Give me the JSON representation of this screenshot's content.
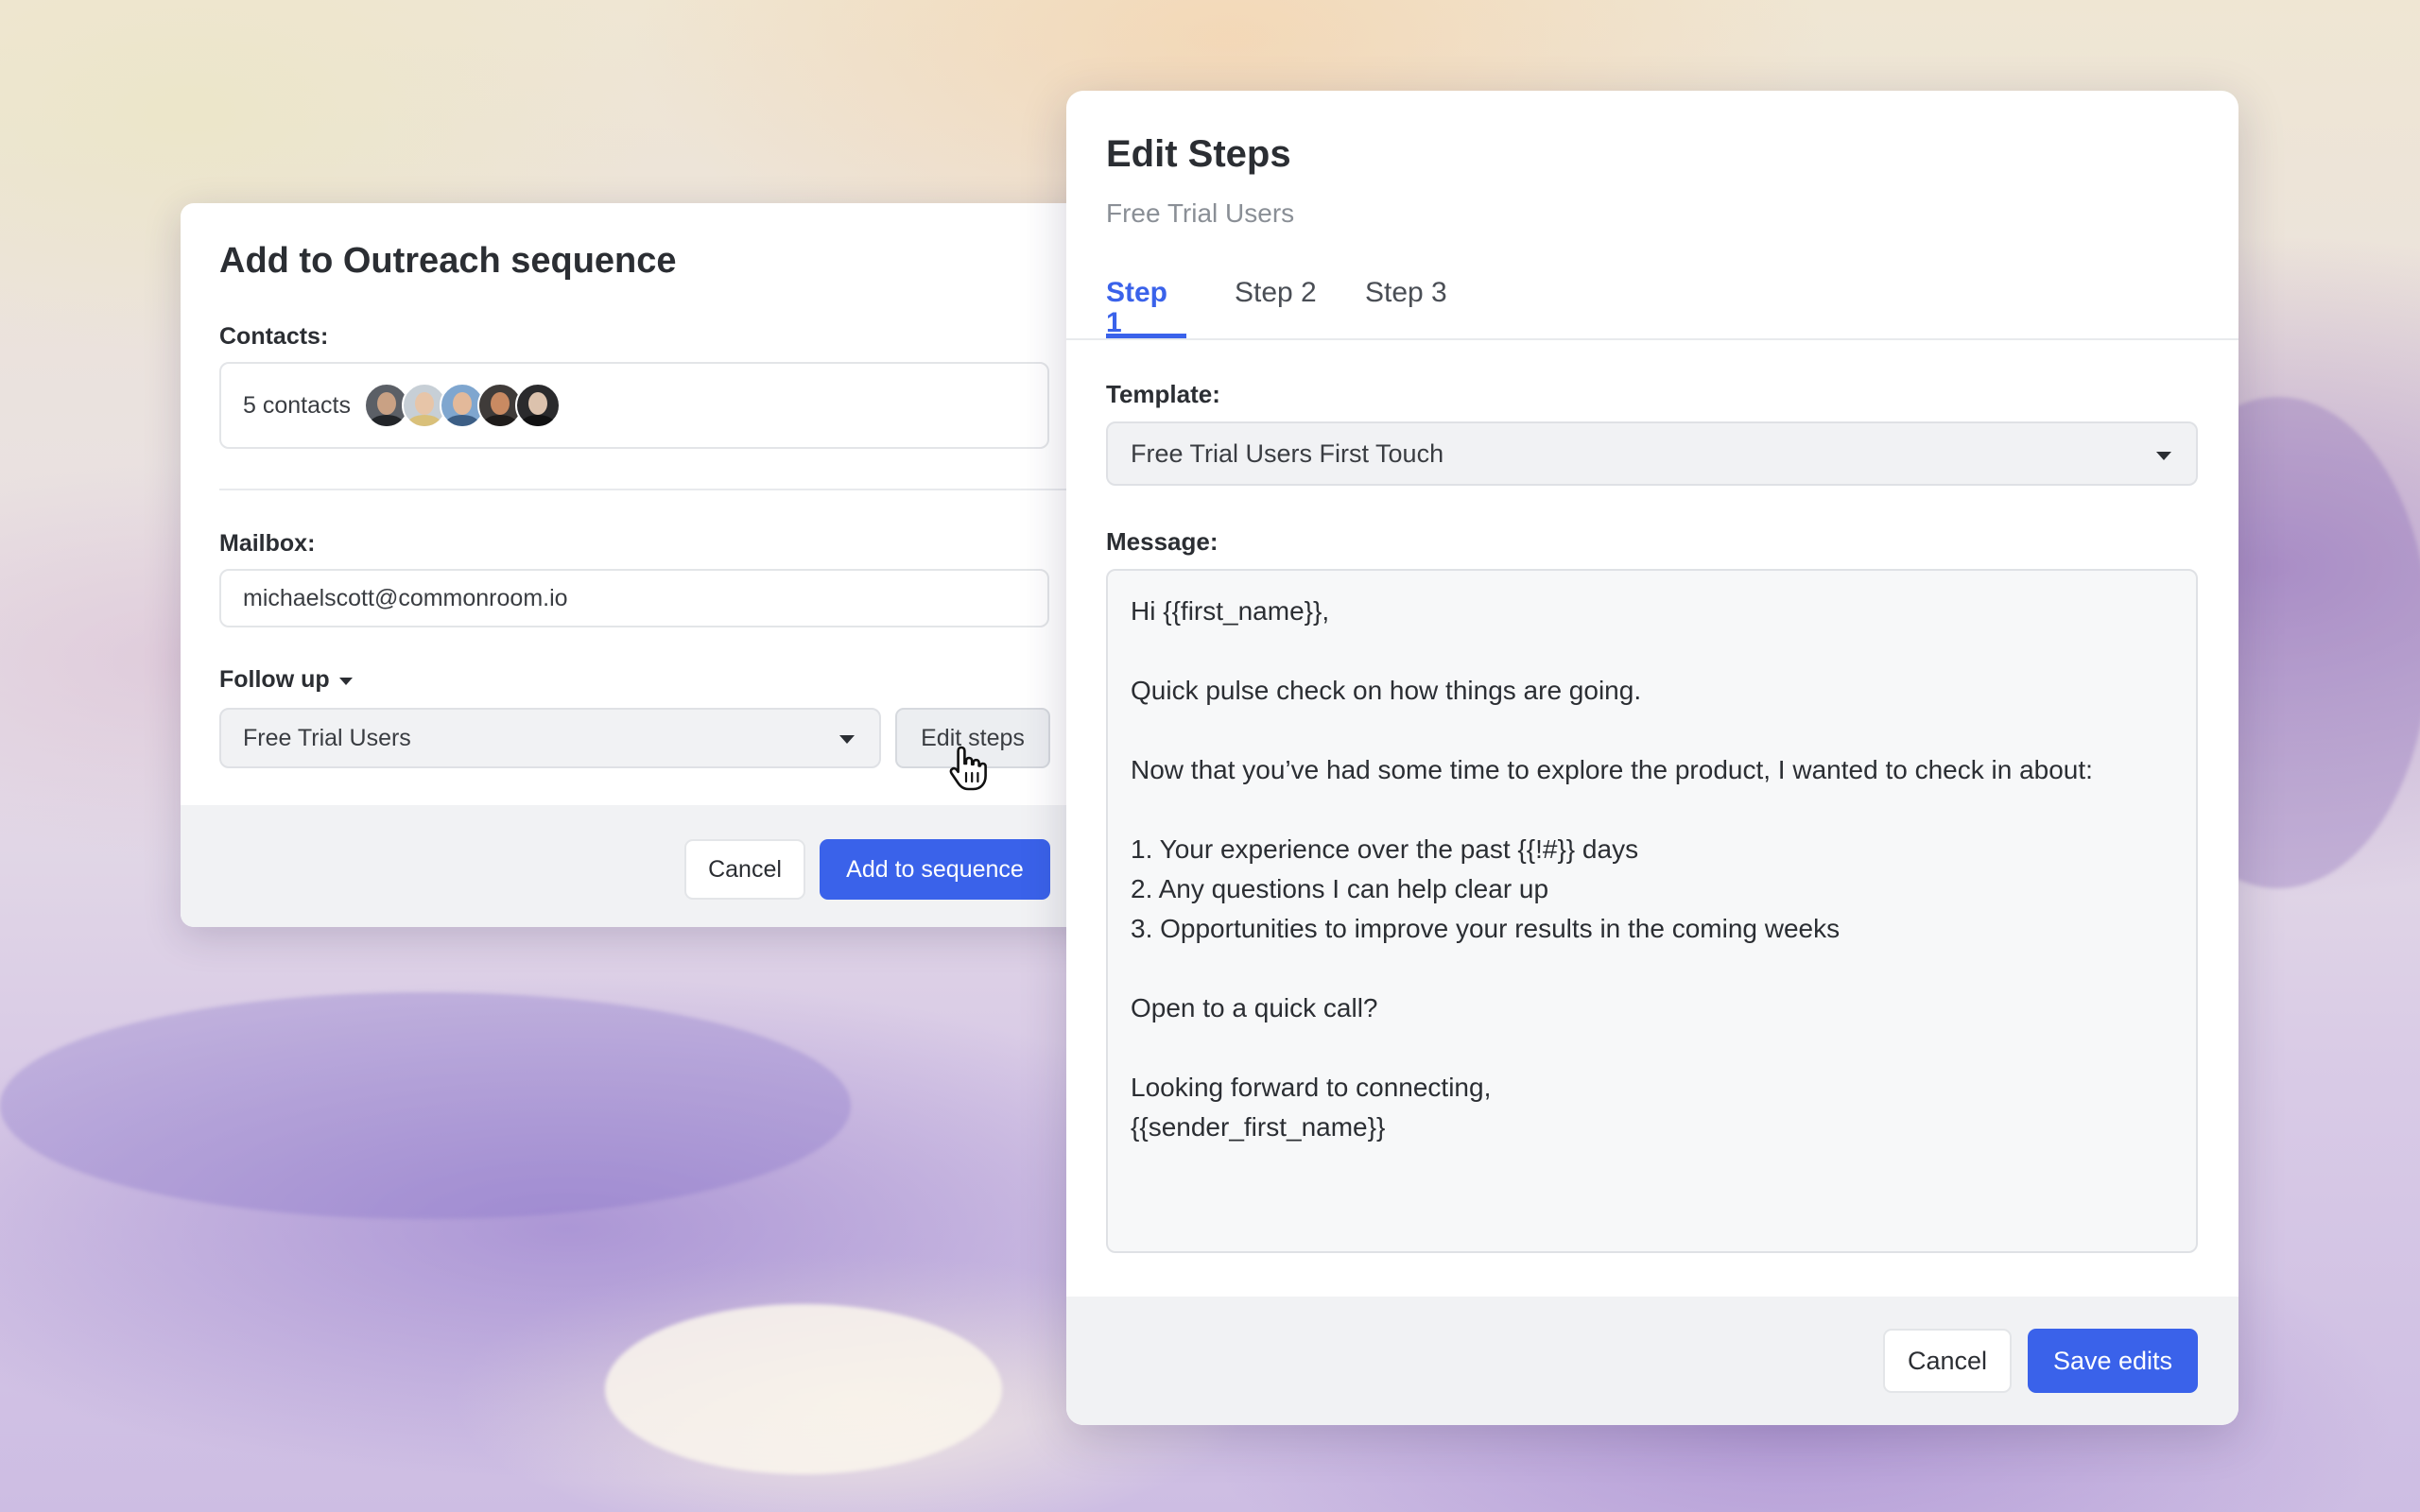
{
  "add_dialog": {
    "title": "Add to Outreach sequence",
    "contacts_label": "Contacts:",
    "contacts_count": "5 contacts",
    "mailbox_label": "Mailbox:",
    "mailbox_value": "michaelscott@commonroom.io",
    "follow_up_label": "Follow up",
    "sequence_value": "Free Trial Users",
    "edit_steps_label": "Edit steps",
    "cancel_label": "Cancel",
    "add_label": "Add to sequence"
  },
  "edit_dialog": {
    "title": "Edit Steps",
    "subtitle": "Free Trial Users",
    "tabs": [
      {
        "label": "Step 1",
        "active": true
      },
      {
        "label": "Step 2",
        "active": false
      },
      {
        "label": "Step 3",
        "active": false
      }
    ],
    "template_label": "Template:",
    "template_value": "Free Trial Users First Touch",
    "message_label": "Message:",
    "message": "Hi {{first_name}},\n\nQuick pulse check on how things are going.\n\nNow that you’ve had some time to explore the product, I wanted to check in about:\n\n1. Your experience over the past {{!#}} days\n2. Any questions I can help clear up\n3. Opportunities to improve your results in the coming weeks\n\nOpen to a quick call?\n\nLooking forward to connecting,\n{{sender_first_name}}",
    "cancel_label": "Cancel",
    "save_label": "Save edits"
  },
  "colors": {
    "primary": "#3a62ea",
    "footer_bg": "#f1f2f4",
    "subtle_text": "#8a8f96"
  },
  "icons": {
    "dropdown": "chevron-down-icon",
    "cursor": "hand-pointer-icon"
  }
}
